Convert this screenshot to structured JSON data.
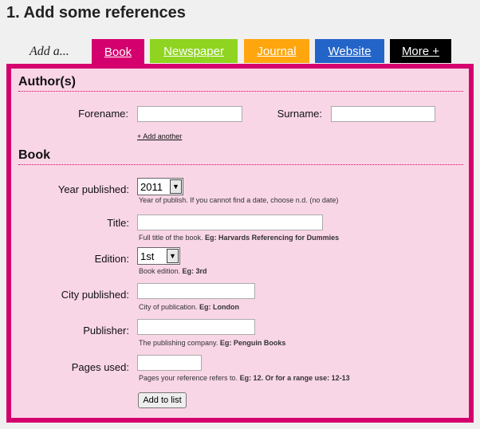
{
  "page": {
    "title": "1. Add some references"
  },
  "tabs": {
    "prefix": "Add a...",
    "items": [
      {
        "label": "Book",
        "color": "#d4006e"
      },
      {
        "label": "Newspaper",
        "color": "#8ed420"
      },
      {
        "label": "Journal",
        "color": "#ffa60e"
      },
      {
        "label": "Website",
        "color": "#2364c8"
      },
      {
        "label": "More +",
        "color": "#000000"
      }
    ]
  },
  "authors": {
    "heading": "Author(s)",
    "forename_label": "Forename:",
    "forename_value": "",
    "surname_label": "Surname:",
    "surname_value": "",
    "add_another": "+ Add another"
  },
  "book": {
    "heading": "Book",
    "year": {
      "label": "Year published:",
      "value": "2011",
      "hint": "Year of publish. If you cannot find a date, choose n.d. (no date)"
    },
    "title": {
      "label": "Title:",
      "value": "",
      "hint_prefix": "Full title of the book. ",
      "hint_example": "Eg: Harvards Referencing for Dummies"
    },
    "edition": {
      "label": "Edition:",
      "value": "1st",
      "hint_prefix": "Book edition. ",
      "hint_example": "Eg: 3rd"
    },
    "city": {
      "label": "City published:",
      "value": "",
      "hint_prefix": "City of publication. ",
      "hint_example": "Eg: London"
    },
    "publisher": {
      "label": "Publisher:",
      "value": "",
      "hint_prefix": "The publishing company. ",
      "hint_example": "Eg: Penguin Books"
    },
    "pages": {
      "label": "Pages used:",
      "value": "",
      "hint_prefix": "Pages your reference refers to. ",
      "hint_example": "Eg: 12. Or for a range use: 12-13"
    },
    "submit_label": "Add to list"
  }
}
